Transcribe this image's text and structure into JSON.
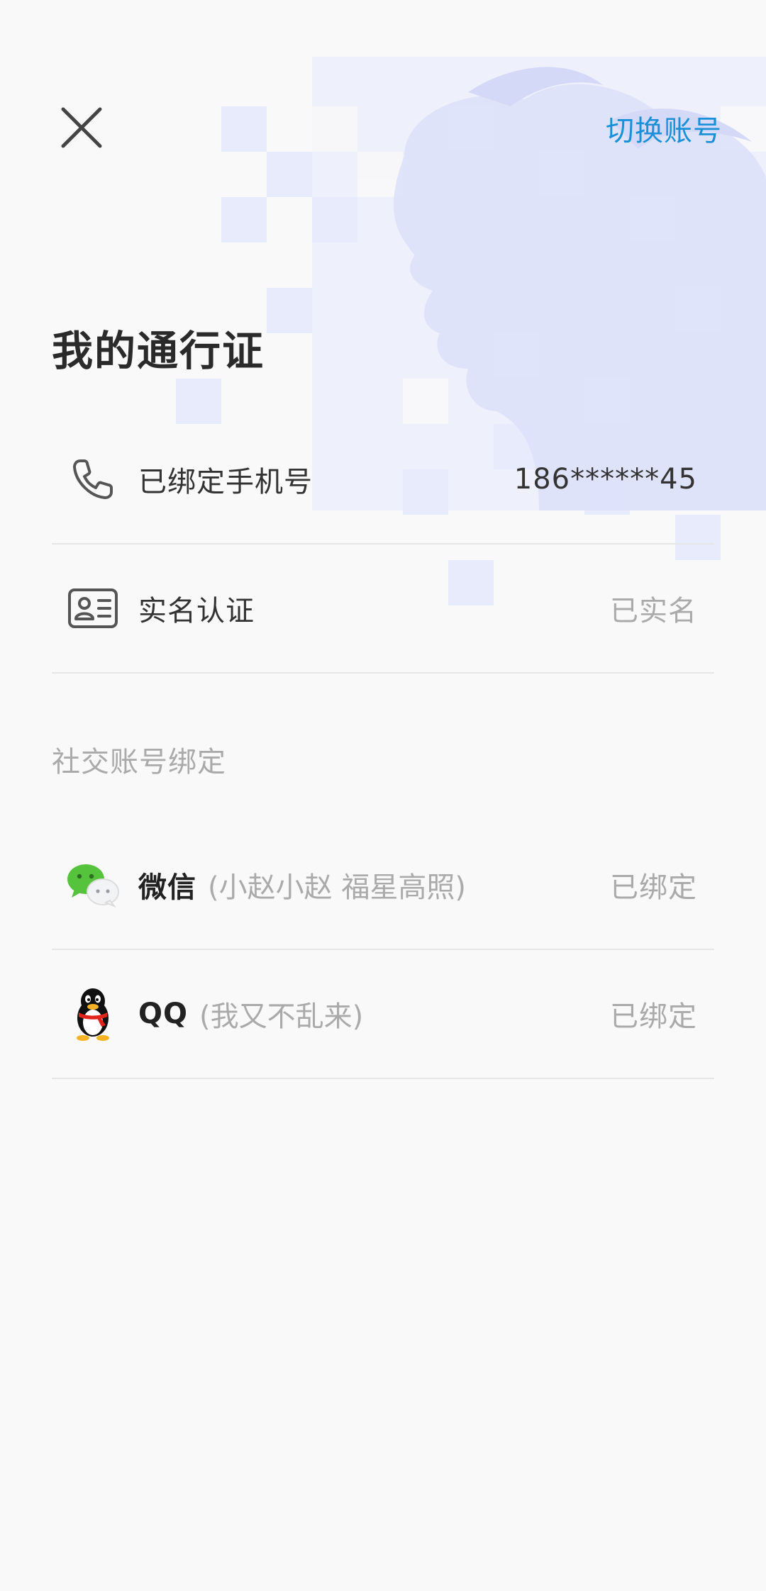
{
  "header": {
    "switch_account_label": "切换账号"
  },
  "page_title": "我的通行证",
  "account_rows": [
    {
      "label": "已绑定手机号",
      "value": "186******45",
      "icon": "phone-icon"
    },
    {
      "label": "实名认证",
      "value": "已实名",
      "icon": "id-card-icon"
    }
  ],
  "social_section_label": "社交账号绑定",
  "social_rows": [
    {
      "name": "微信",
      "nickname": "(小赵小赵 福星高照)",
      "status": "已绑定",
      "icon": "wechat-icon"
    },
    {
      "name": "QQ",
      "nickname": "(我又不乱来)",
      "status": "已绑定",
      "icon": "qq-icon"
    }
  ],
  "colors": {
    "accent": "#1a90d8",
    "background": "#f9f9f9",
    "muted_text": "#aaaaaa",
    "divider": "#e6e6e6"
  }
}
